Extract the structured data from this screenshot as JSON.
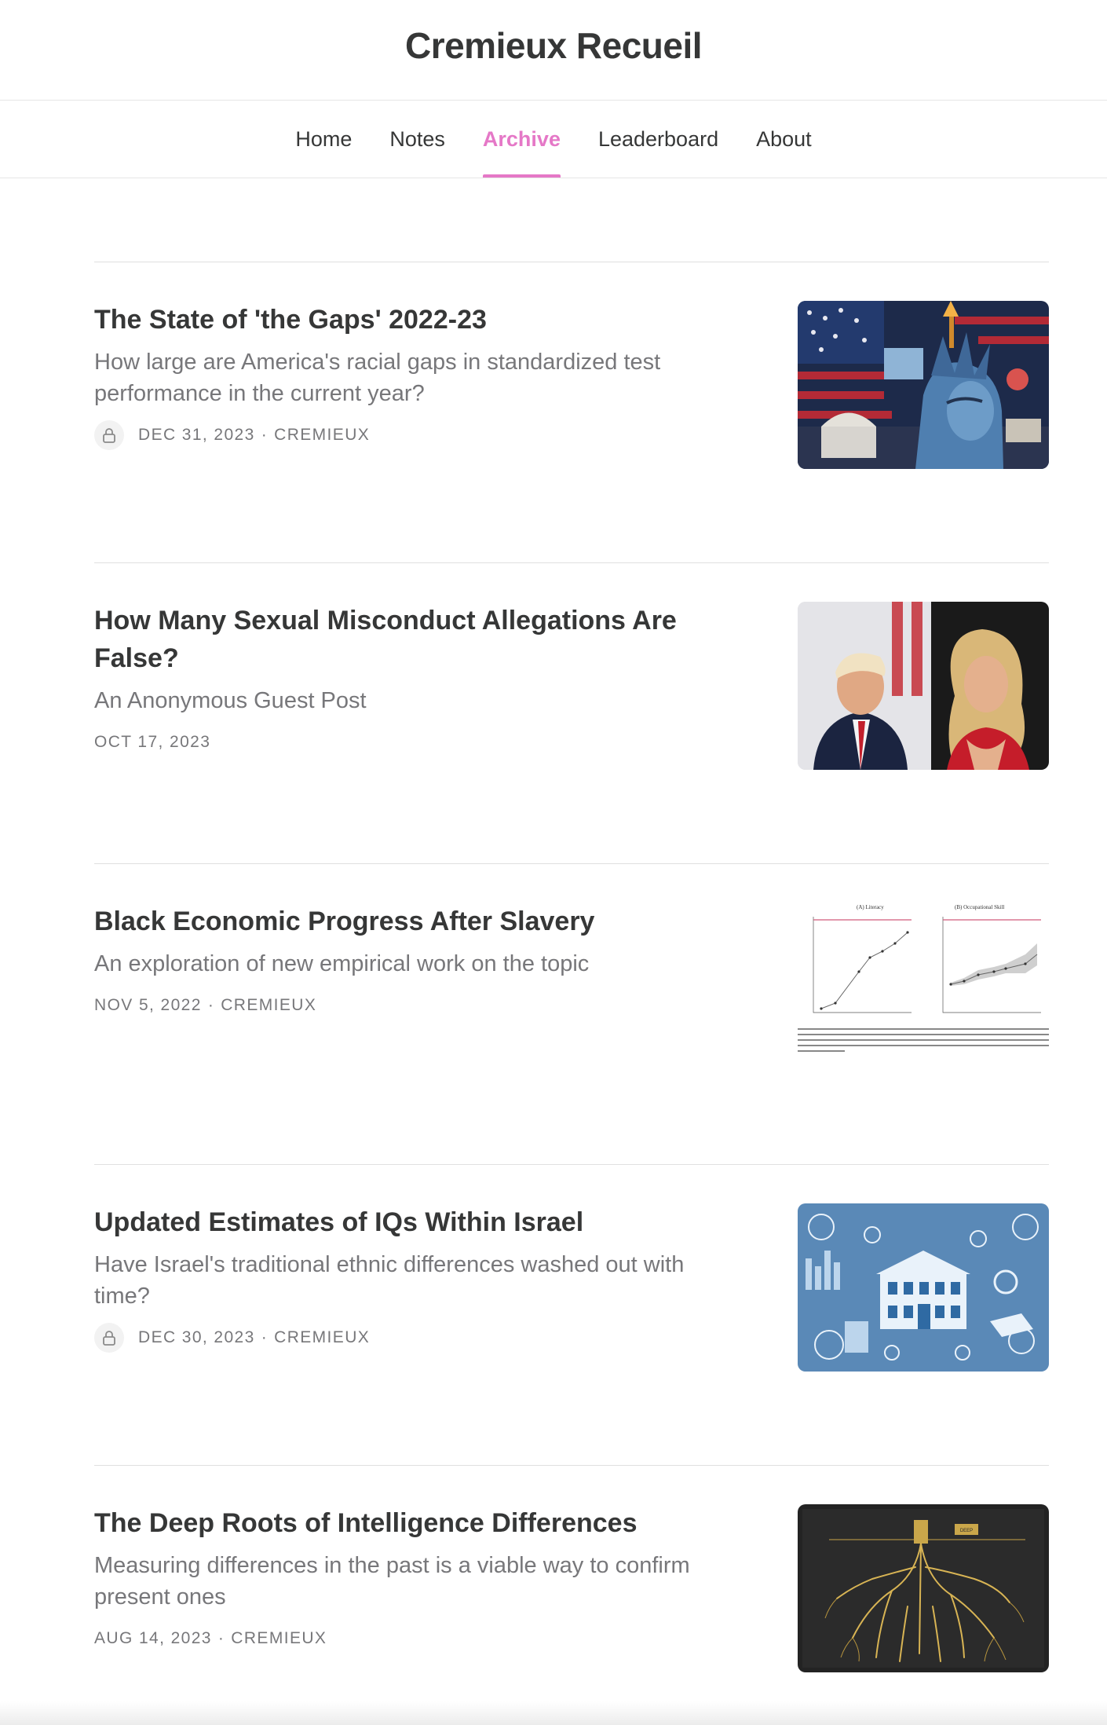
{
  "site": {
    "title": "Cremieux Recueil"
  },
  "nav": {
    "tabs": [
      {
        "label": "Home"
      },
      {
        "label": "Notes"
      },
      {
        "label": "Archive",
        "active": true
      },
      {
        "label": "Leaderboard"
      },
      {
        "label": "About"
      }
    ]
  },
  "accent_color": "#e578c7",
  "posts": [
    {
      "title": "The State of 'the Gaps' 2022-23",
      "subtitle": "How large are America's racial gaps in standardized test performance in the current year?",
      "date": "DEC 31, 2023",
      "author": "CREMIEUX",
      "locked": true,
      "thumbnail_icon": "statue-of-liberty-collage-image"
    },
    {
      "title": "How Many Sexual Misconduct Allegations Are False?",
      "subtitle": "An Anonymous Guest Post",
      "date": "OCT 17, 2023",
      "author": "",
      "locked": false,
      "thumbnail_icon": "two-person-photo-image"
    },
    {
      "title": "Black Economic Progress After Slavery",
      "subtitle": "An exploration of new empirical work on the topic",
      "date": "NOV 5, 2022",
      "author": "CREMIEUX",
      "locked": false,
      "thumbnail_icon": "literacy-occupation-charts-image",
      "thumbnail_labels": {
        "left": "(A) Literacy",
        "right": "(B) Occupational Skill"
      }
    },
    {
      "title": "Updated Estimates of IQs Within Israel",
      "subtitle": "Have Israel's traditional ethnic differences washed out with time?",
      "date": "DEC 30, 2023",
      "author": "CREMIEUX",
      "locked": true,
      "thumbnail_icon": "blue-science-collage-image"
    },
    {
      "title": "The Deep Roots of Intelligence Differences",
      "subtitle": "Measuring differences in the past is a viable way to confirm present ones",
      "date": "AUG 14, 2023",
      "author": "CREMIEUX",
      "locked": false,
      "thumbnail_icon": "golden-tree-roots-image",
      "thumbnail_labels": {
        "sign": "DEEP"
      }
    }
  ]
}
